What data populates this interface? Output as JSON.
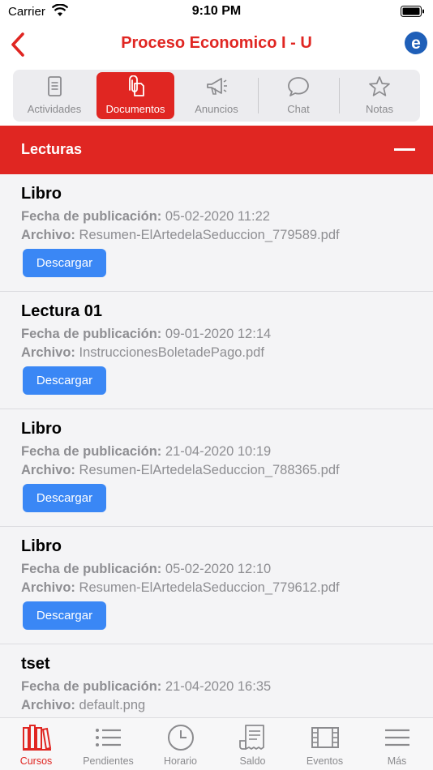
{
  "status_bar": {
    "carrier": "Carrier",
    "time": "9:10 PM"
  },
  "nav": {
    "title": "Proceso Economico I - U",
    "logo_letter": "e"
  },
  "colors": {
    "brand_red": "#e02622",
    "button_blue": "#3a87f5",
    "inactive_gray": "#8b8b8e"
  },
  "segments": [
    {
      "label": "Actividades",
      "icon": "document-icon",
      "active": false
    },
    {
      "label": "Documentos",
      "icon": "attachment-icon",
      "active": true
    },
    {
      "label": "Anuncios",
      "icon": "megaphone-icon",
      "active": false
    },
    {
      "label": "Chat",
      "icon": "chat-bubble-icon",
      "active": false
    },
    {
      "label": "Notas",
      "icon": "star-icon",
      "active": false
    }
  ],
  "section": {
    "title": "Lecturas"
  },
  "labels": {
    "date": "Fecha de publicación:",
    "file": "Archivo:",
    "download": "Descargar"
  },
  "documents": [
    {
      "title": "Libro",
      "date": "05-02-2020 11:22",
      "file": "Resumen-ElArtedelaSeduccion_779589.pdf"
    },
    {
      "title": "Lectura 01",
      "date": "09-01-2020 12:14",
      "file": "InstruccionesBoletadePago.pdf"
    },
    {
      "title": "Libro",
      "date": "21-04-2020 10:19",
      "file": "Resumen-ElArtedelaSeduccion_788365.pdf"
    },
    {
      "title": "Libro",
      "date": "05-02-2020 12:10",
      "file": "Resumen-ElArtedelaSeduccion_779612.pdf"
    },
    {
      "title": "tset",
      "date": "21-04-2020 16:35",
      "file": "default.png"
    }
  ],
  "tabs": [
    {
      "label": "Cursos",
      "icon": "books-icon",
      "active": true
    },
    {
      "label": "Pendientes",
      "icon": "list-icon",
      "active": false
    },
    {
      "label": "Horario",
      "icon": "clock-icon",
      "active": false
    },
    {
      "label": "Saldo",
      "icon": "receipt-icon",
      "active": false
    },
    {
      "label": "Eventos",
      "icon": "film-icon",
      "active": false
    },
    {
      "label": "Más",
      "icon": "menu-icon",
      "active": false
    }
  ]
}
